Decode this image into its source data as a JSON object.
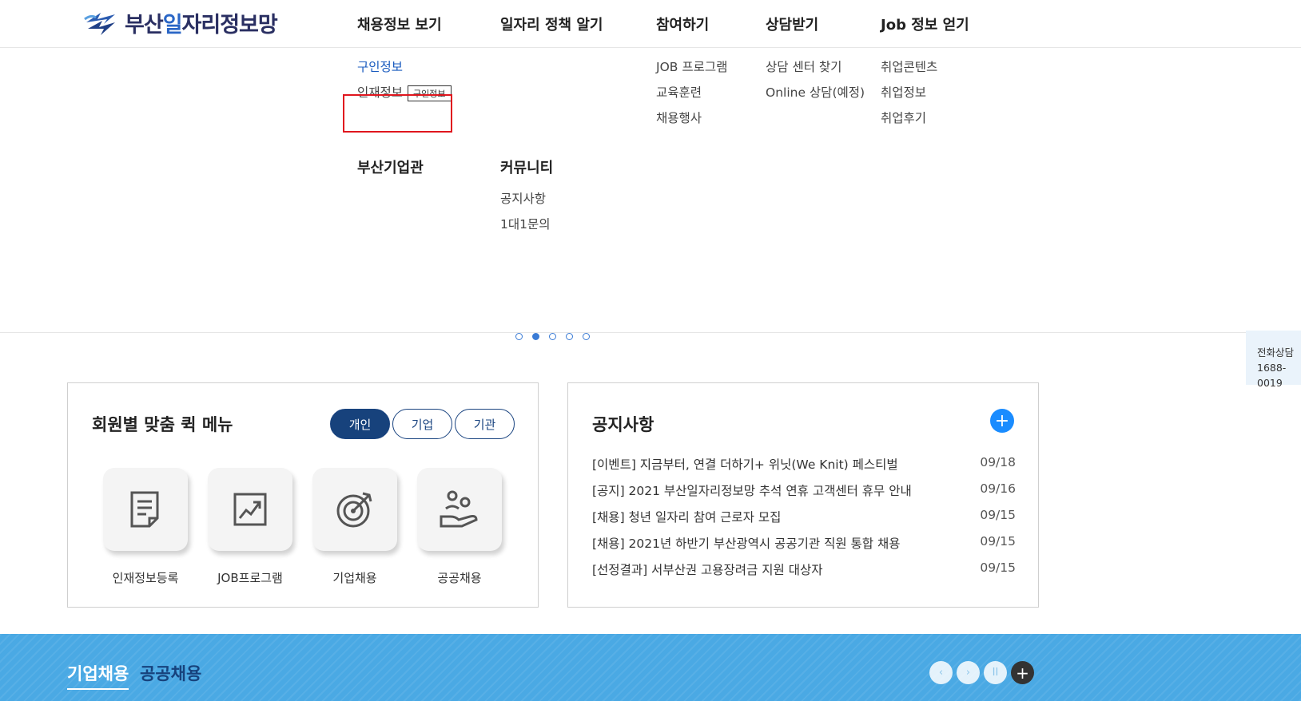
{
  "logo": {
    "pre": "부산",
    "hl": "일",
    "post": "자리정보망"
  },
  "gnb": [
    {
      "label": "채용정보 보기"
    },
    {
      "label": "일자리 정책 알기"
    },
    {
      "label": "참여하기"
    },
    {
      "label": "상담받기"
    },
    {
      "label": "Job 정보 얻기"
    }
  ],
  "mega": {
    "col1": {
      "items": [
        "구인정보",
        "인재정보"
      ],
      "tag": "구인정보"
    },
    "col3": {
      "items": [
        "JOB 프로그램",
        "교육훈련",
        "채용행사"
      ]
    },
    "col4": {
      "items": [
        "상담 센터 찾기",
        "Online 상담(예정)"
      ]
    },
    "col5": {
      "items": [
        "취업콘텐츠",
        "취업정보",
        "취업후기"
      ]
    },
    "sec2": {
      "a_title": "부산기업관",
      "b_title": "커뮤니티",
      "b_items": [
        "공지사항",
        "1대1문의"
      ]
    }
  },
  "phone": {
    "label": "전화상담",
    "number": "1688-0019"
  },
  "quick_menu": {
    "title": "회원별 맞춤 퀵 메뉴",
    "pills": [
      "개인",
      "기업",
      "기관"
    ],
    "active_pill": "개인",
    "items": [
      {
        "label": "인재정보등록",
        "icon": "document-icon"
      },
      {
        "label": "JOB프로그램",
        "icon": "chart-icon"
      },
      {
        "label": "기업채용",
        "icon": "target-icon"
      },
      {
        "label": "공공채용",
        "icon": "hand-people-icon"
      }
    ]
  },
  "notice": {
    "title": "공지사항",
    "more": "+",
    "rows": [
      {
        "title": "[이벤트] 지금부터, 연결 더하기+ 위닛(We Knit) 페스티벌",
        "date": "09/18"
      },
      {
        "title": "[공지] 2021 부산일자리정보망 추석 연휴 고객센터 휴무 안내",
        "date": "09/16"
      },
      {
        "title": "[채용] 청년 일자리 참여 근로자 모집",
        "date": "09/15"
      },
      {
        "title": "[채용] 2021년 하반기 부산광역시 공공기관 직원 통합 채용",
        "date": "09/15"
      },
      {
        "title": "[선정결과] 서부산권 고용장려금 지원 대상자",
        "date": "09/15"
      }
    ]
  },
  "band": {
    "tabs": [
      "기업채용",
      "공공채용"
    ],
    "controls": {
      "prev": "‹",
      "next": "›",
      "pause": "II",
      "more": "+"
    }
  },
  "colors": {
    "primary": "#17427c",
    "accent": "#1a8cff",
    "band": "#4aa9e4",
    "highlight": "#e0161e"
  }
}
